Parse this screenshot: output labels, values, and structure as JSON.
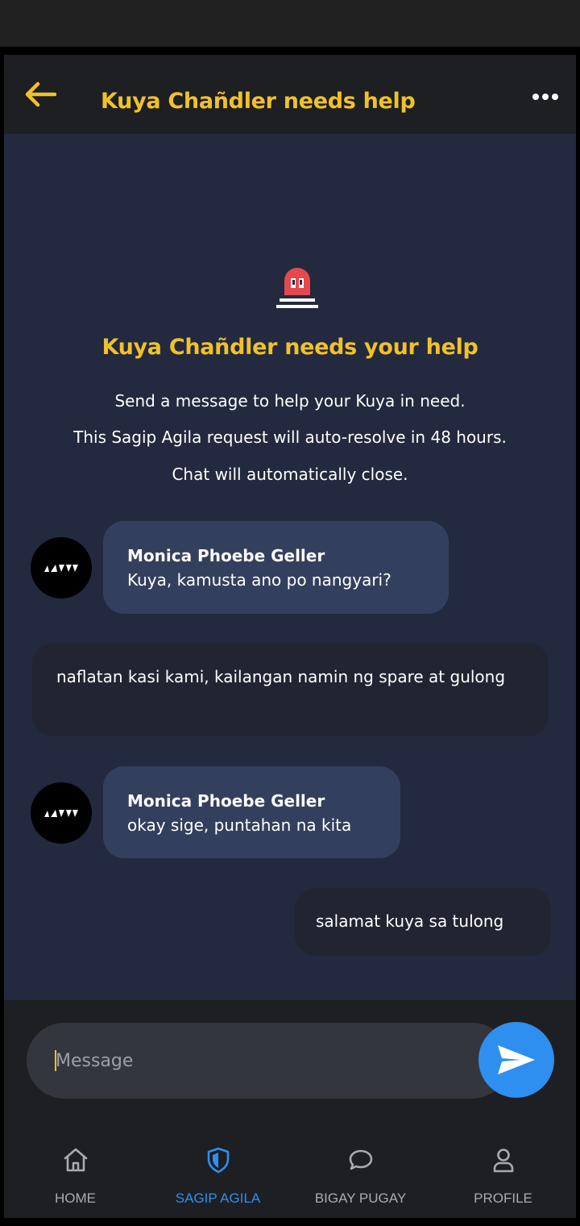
{
  "header": {
    "title": "Kuya Chañdler needs help",
    "back_icon": "arrow-left-icon",
    "more_icon": "more-horizontal-icon"
  },
  "intro": {
    "icon": "alarm-siren-icon",
    "headline": "Kuya Chañdler needs your help",
    "lines": [
      "Send a message to help your Kuya in need.",
      "This Sagip Agila request will auto-resolve in 48 hours.",
      "Chat will automatically close."
    ]
  },
  "messages": [
    {
      "direction": "incoming",
      "sender": "Monica Phoebe Geller",
      "text": "Kuya, kamusta ano po nangyari?"
    },
    {
      "direction": "outgoing",
      "text": "naflatan kasi kami, kailangan namin ng spare at gulong"
    },
    {
      "direction": "incoming",
      "sender": "Monica Phoebe Geller",
      "text": "okay sige, puntahan na kita"
    },
    {
      "direction": "outgoing",
      "text": "salamat kuya sa tulong"
    }
  ],
  "composer": {
    "placeholder": "Message",
    "send_icon": "send-icon"
  },
  "nav": {
    "items": [
      {
        "label": "HOME",
        "icon": "home-icon",
        "active": false
      },
      {
        "label": "SAGIP AGILA",
        "icon": "shield-icon",
        "active": true
      },
      {
        "label": "BIGAY PUGAY",
        "icon": "chat-bubble-icon",
        "active": false
      },
      {
        "label": "PROFILE",
        "icon": "user-icon",
        "active": false
      }
    ]
  },
  "colors": {
    "accent_yellow": "#f1c12b",
    "chat_background": "#23293e",
    "incoming_bubble": "#33405d",
    "outgoing_bubble": "#222531",
    "active_blue": "#2e8ff0",
    "bar_background": "#1e1f22"
  }
}
